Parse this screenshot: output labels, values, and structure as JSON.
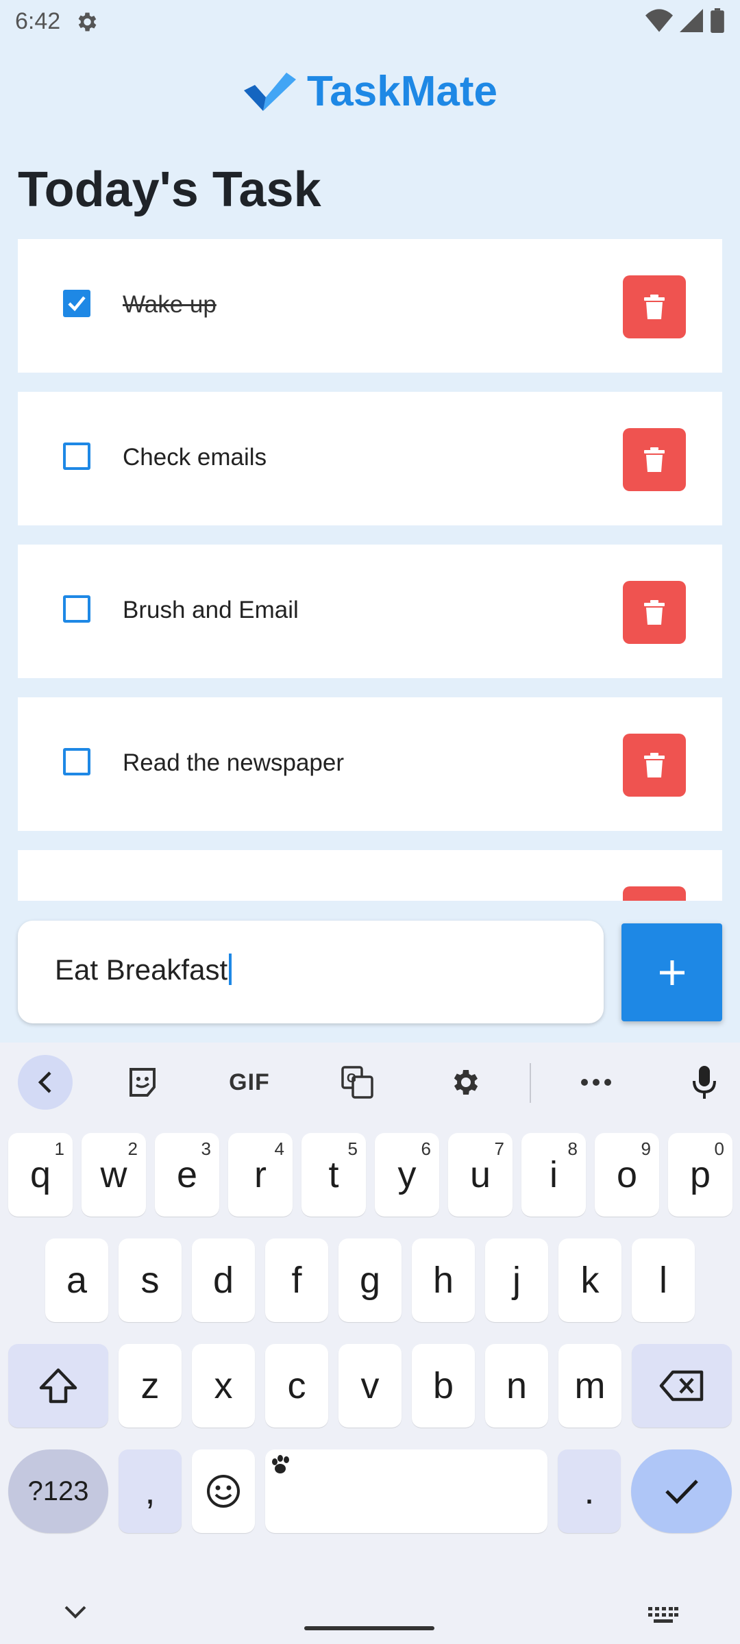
{
  "status_bar": {
    "time": "6:42",
    "icons": [
      "gear-icon",
      "wifi-icon",
      "signal-icon",
      "battery-icon"
    ]
  },
  "app": {
    "title": "TaskMate",
    "logo_icon": "checkmark-logo-icon"
  },
  "page_title": "Today's Task",
  "tasks": [
    {
      "label": "Wake up",
      "done": true
    },
    {
      "label": "Check emails",
      "done": false
    },
    {
      "label": "Brush and Email",
      "done": false
    },
    {
      "label": "Read the newspaper",
      "done": false
    },
    {
      "label": "",
      "done": false
    }
  ],
  "new_task": {
    "value": "Eat Breakfast",
    "add_icon": "plus-icon"
  },
  "keyboard": {
    "toolbar": {
      "gif_label": "GIF",
      "icons": [
        "back-icon",
        "sticker-icon",
        "gif-icon",
        "translate-icon",
        "settings-icon",
        "more-icon",
        "mic-icon"
      ]
    },
    "row1": [
      {
        "key": "q",
        "hint": "1"
      },
      {
        "key": "w",
        "hint": "2"
      },
      {
        "key": "e",
        "hint": "3"
      },
      {
        "key": "r",
        "hint": "4"
      },
      {
        "key": "t",
        "hint": "5"
      },
      {
        "key": "y",
        "hint": "6"
      },
      {
        "key": "u",
        "hint": "7"
      },
      {
        "key": "i",
        "hint": "8"
      },
      {
        "key": "o",
        "hint": "9"
      },
      {
        "key": "p",
        "hint": "0"
      }
    ],
    "row2": [
      "a",
      "s",
      "d",
      "f",
      "g",
      "h",
      "j",
      "k",
      "l"
    ],
    "row3": [
      "z",
      "x",
      "c",
      "v",
      "b",
      "n",
      "m"
    ],
    "row4": {
      "symbols": "?123",
      "comma": ",",
      "period": "."
    }
  },
  "colors": {
    "accent": "#1e88e5",
    "delete": "#ef5350",
    "background": "#e3effa"
  }
}
